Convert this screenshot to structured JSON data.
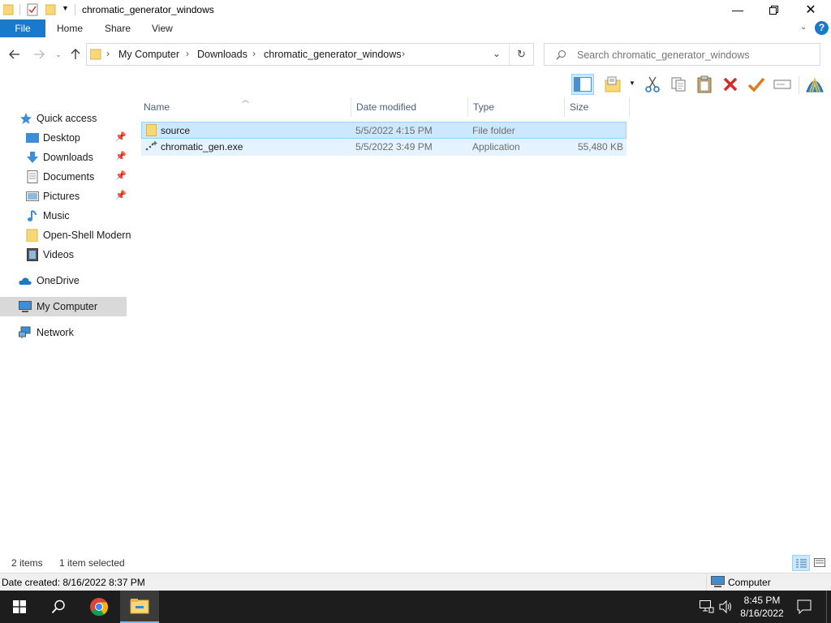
{
  "window": {
    "title": "chromatic_generator_windows"
  },
  "ribbon": {
    "tabs": [
      "File",
      "Home",
      "Share",
      "View"
    ]
  },
  "address": {
    "crumbs": [
      "My Computer",
      "Downloads",
      "chromatic_generator_windows"
    ]
  },
  "search": {
    "placeholder": "Search chromatic_generator_windows"
  },
  "sidebar": {
    "items": [
      {
        "label": "Quick access",
        "icon": "star-icon"
      },
      {
        "label": "Desktop",
        "icon": "desktop-icon",
        "pinned": true
      },
      {
        "label": "Downloads",
        "icon": "download-icon",
        "pinned": true
      },
      {
        "label": "Documents",
        "icon": "documents-icon",
        "pinned": true
      },
      {
        "label": "Pictures",
        "icon": "pictures-icon",
        "pinned": true
      },
      {
        "label": "Music",
        "icon": "music-icon"
      },
      {
        "label": "Open-Shell Modern",
        "icon": "folder-icon"
      },
      {
        "label": "Videos",
        "icon": "videos-icon"
      },
      {
        "label": "OneDrive",
        "icon": "cloud-icon"
      },
      {
        "label": "My Computer",
        "icon": "computer-icon",
        "selected": true
      },
      {
        "label": "Network",
        "icon": "network-icon"
      }
    ]
  },
  "columns": [
    "Name",
    "Date modified",
    "Type",
    "Size"
  ],
  "files": [
    {
      "name": "source",
      "date": "5/5/2022 4:15 PM",
      "type": "File folder",
      "size": "",
      "icon": "folder-icon"
    },
    {
      "name": "chromatic_gen.exe",
      "date": "5/5/2022 3:49 PM",
      "type": "Application",
      "size": "55,480 KB",
      "icon": "exe-icon"
    }
  ],
  "status": {
    "items": "2 items",
    "selected": "1 item selected"
  },
  "info": {
    "date_created": "Date created: 8/16/2022 8:37 PM",
    "location": "Computer"
  },
  "taskbar": {
    "time": "8:45 PM",
    "date": "8/16/2022"
  },
  "colors": {
    "accent": "#1979ca",
    "selection": "#cce8ff",
    "folder": "#f8d775"
  }
}
